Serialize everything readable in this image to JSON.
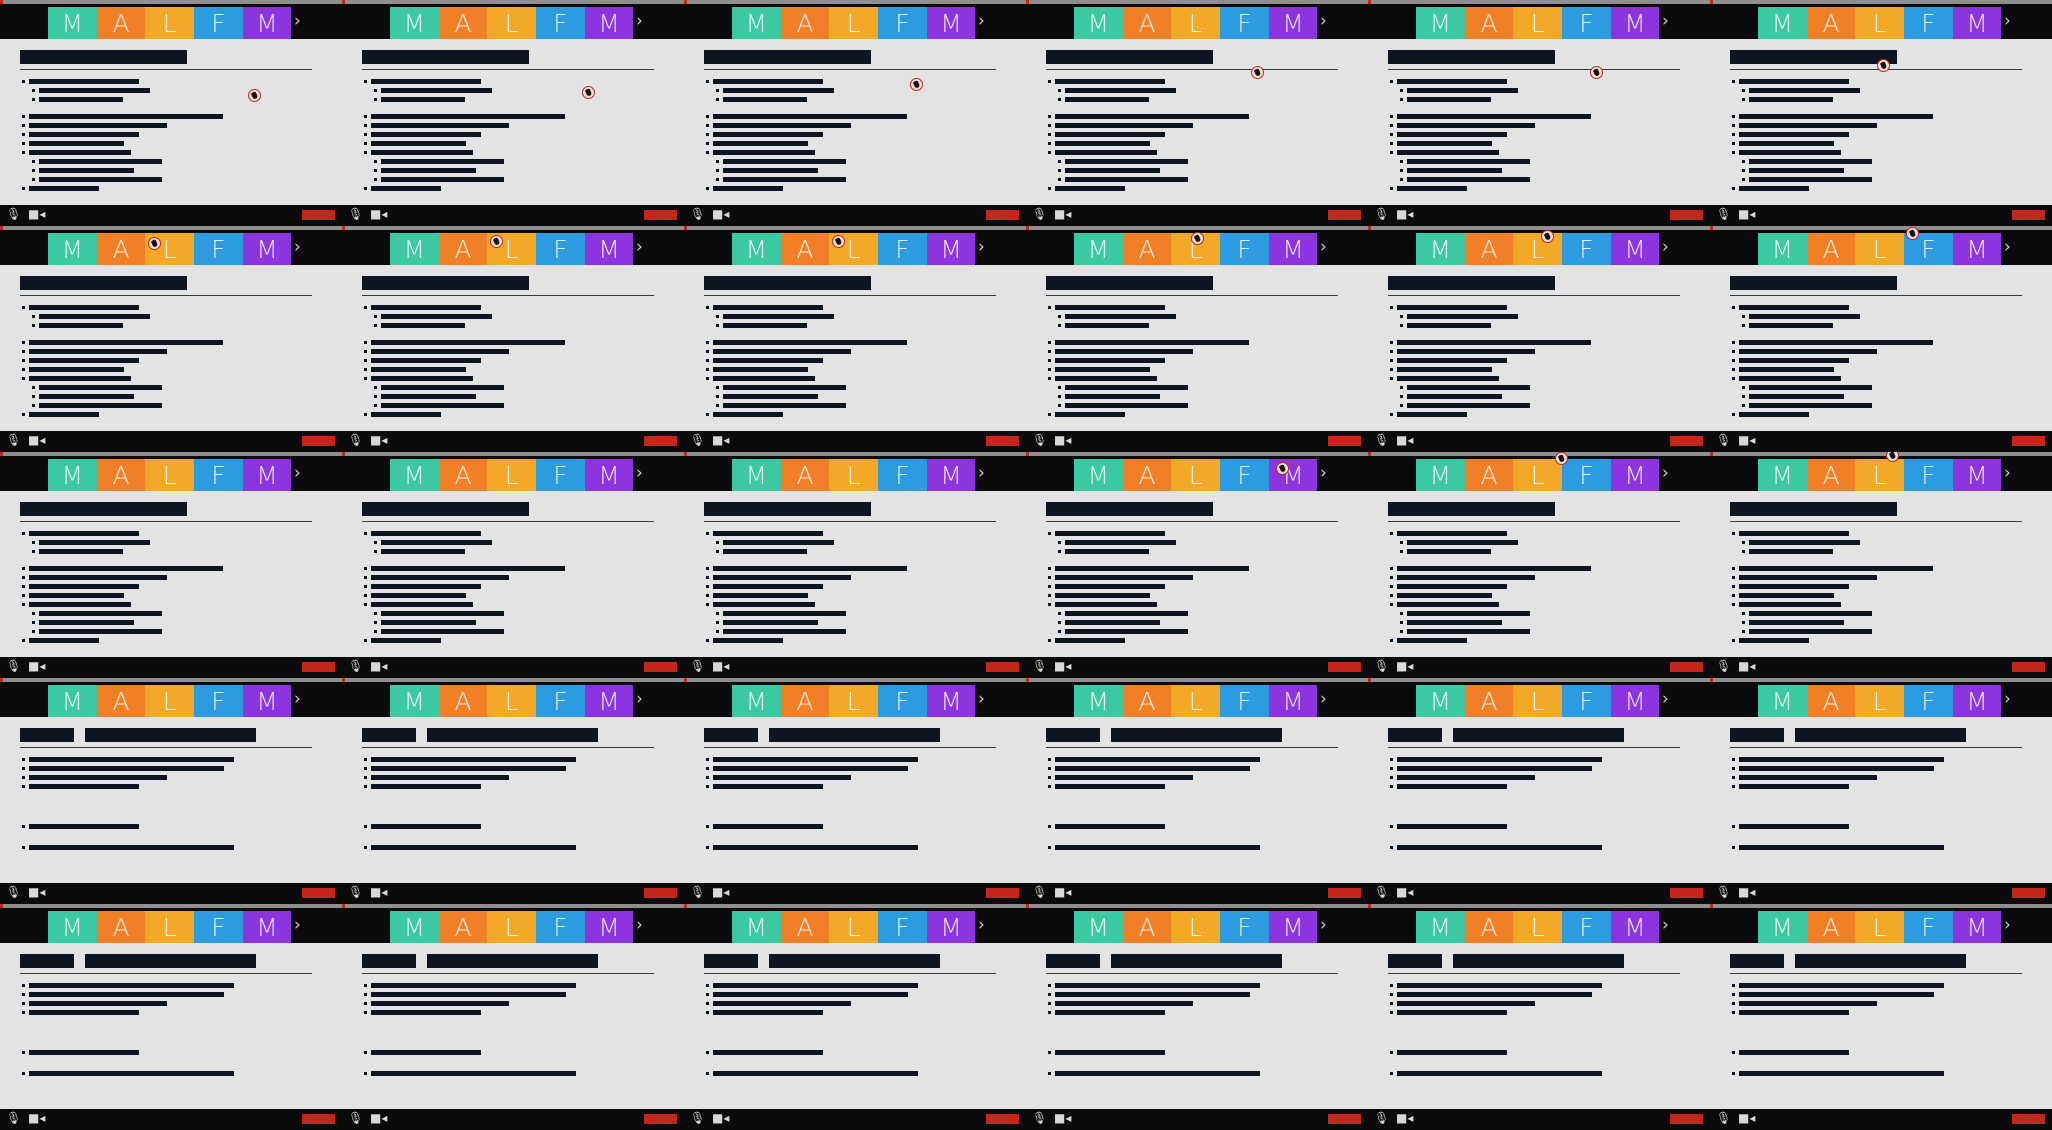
{
  "nav": {
    "tabs": [
      {
        "label": "M",
        "color": "#3cc9a1"
      },
      {
        "label": "A",
        "color": "#f07f27"
      },
      {
        "label": "L",
        "color": "#f2a928"
      },
      {
        "label": "F",
        "color": "#2c9be0"
      },
      {
        "label": "M",
        "color": "#8c34e0"
      }
    ],
    "chevron": "›"
  },
  "controls": {
    "mic_icon": "microphone-icon",
    "camera_icon": "video-camera-icon",
    "mic_glyph": "🎙",
    "camera_glyph": "■◂",
    "record_color": "#c4261b"
  },
  "frames_count": 30
}
